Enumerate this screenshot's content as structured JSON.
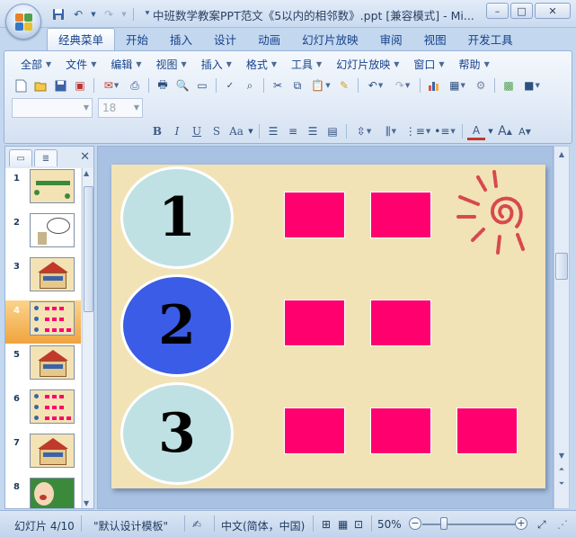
{
  "window": {
    "title": "中班数学教案PPT范文《5以内的相邻数》.ppt [兼容模式] - Mi...",
    "minimize": "–",
    "maximize": "□",
    "close": "✕"
  },
  "qat": {
    "save_icon": "save-icon",
    "undo_icon": "undo-icon",
    "redo_icon": "redo-icon",
    "customize_icon": "qat-dropdown-icon"
  },
  "tabs": [
    "经典菜单",
    "开始",
    "插入",
    "设计",
    "动画",
    "幻灯片放映",
    "审阅",
    "视图",
    "开发工具"
  ],
  "active_tab": "经典菜单",
  "menu": [
    "全部",
    "文件",
    "编辑",
    "视图",
    "插入",
    "格式",
    "工具",
    "幻灯片放映",
    "窗口",
    "帮助"
  ],
  "font": {
    "name": "",
    "size": "18"
  },
  "format_buttons": {
    "bold": "B",
    "italic": "I",
    "underline": "U",
    "strike": "S",
    "case": "Aa",
    "font_color": "A",
    "grow": "A",
    "shrink": "A"
  },
  "panel": {
    "close": "✕",
    "slides": [
      {
        "num": "1"
      },
      {
        "num": "2"
      },
      {
        "num": "3"
      },
      {
        "num": "4"
      },
      {
        "num": "5"
      },
      {
        "num": "6"
      },
      {
        "num": "7"
      },
      {
        "num": "8"
      }
    ],
    "selected": "4"
  },
  "slide": {
    "numbers": [
      "1",
      "2",
      "3"
    ],
    "rows": [
      2,
      2,
      3
    ],
    "colors": {
      "background": "#f1e3b5",
      "circle_light": "#bfe1e4",
      "circle_dark": "#3a5ce6",
      "square": "#ff006e"
    }
  },
  "status": {
    "slide_counter": "幻灯片 4/10",
    "theme": "\"默认设计模板\"",
    "language": "中文(简体，中国)",
    "zoom": "50%",
    "zoom_out": "−",
    "zoom_in": "+"
  }
}
